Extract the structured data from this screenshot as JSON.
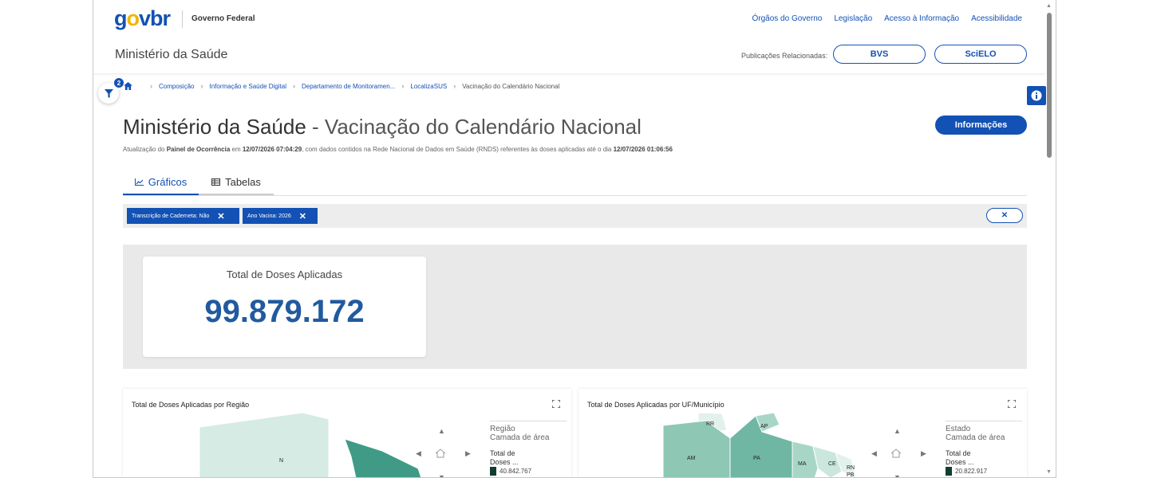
{
  "header": {
    "logo": {
      "g": "g",
      "o": "o",
      "v": "v",
      ".": ".",
      "br": "br"
    },
    "gov_label": "Governo Federal",
    "links": [
      "Órgãos do Governo",
      "Legislação",
      "Acesso à Informação",
      "Acessibilidade"
    ],
    "ministry": "Ministério da Saúde",
    "related_label": "Publicações Relacionadas:",
    "bvs": "BVS",
    "scielo": "SciELO"
  },
  "filter_badge": "2",
  "breadcrumb": [
    "Composição",
    "Informação e Saúde Digital",
    "Departamento de Monitoramen...",
    "LocalizaSUS",
    "Vacinação do Calendário Nacional"
  ],
  "title": {
    "part1": "Ministério da Saúde",
    "dash": " - ",
    "part2": "Vacinação do Calendário Nacional"
  },
  "update": {
    "t1": "Atualização do ",
    "b1": "Painel de Ocorrência",
    "t2": " em ",
    "b2": "12/07/2026 07:04:29",
    "t3": ", com dados contidos na Rede Nacional de Dados em Saúde (RNDS) referentes às doses aplicadas até o dia ",
    "b3": "12/07/2026 01:06:56"
  },
  "info_button": "Informações",
  "tabs": {
    "graficos": "Gráficos",
    "tabelas": "Tabelas"
  },
  "chips": [
    "Transcrição de Caderneta: Não",
    "Ano Vacina: 2026"
  ],
  "kpi": {
    "label": "Total de Doses Aplicadas",
    "value": "99.879.172"
  },
  "panel_left": {
    "title": "Total de Doses Aplicadas por Região",
    "legend1": "Região",
    "legend2": "Camada de área",
    "legend3a": "Total de",
    "legend3b": "Doses ...",
    "value": "40.842.767",
    "map_labels": [
      "N"
    ]
  },
  "panel_right": {
    "title": "Total de Doses Aplicadas por UF/Município",
    "legend1": "Estado",
    "legend2": "Camada de área",
    "legend3a": "Total de",
    "legend3b": "Doses ...",
    "value": "20.822.917",
    "map_labels": [
      "RR",
      "AP",
      "AM",
      "PA",
      "MA",
      "CE",
      "RN",
      "PB"
    ]
  },
  "colors": {
    "primary": "#1351b4",
    "map_dark": "#3f9b85",
    "map_light": "#d5ebe4",
    "legend_swatch": "#123d33"
  }
}
